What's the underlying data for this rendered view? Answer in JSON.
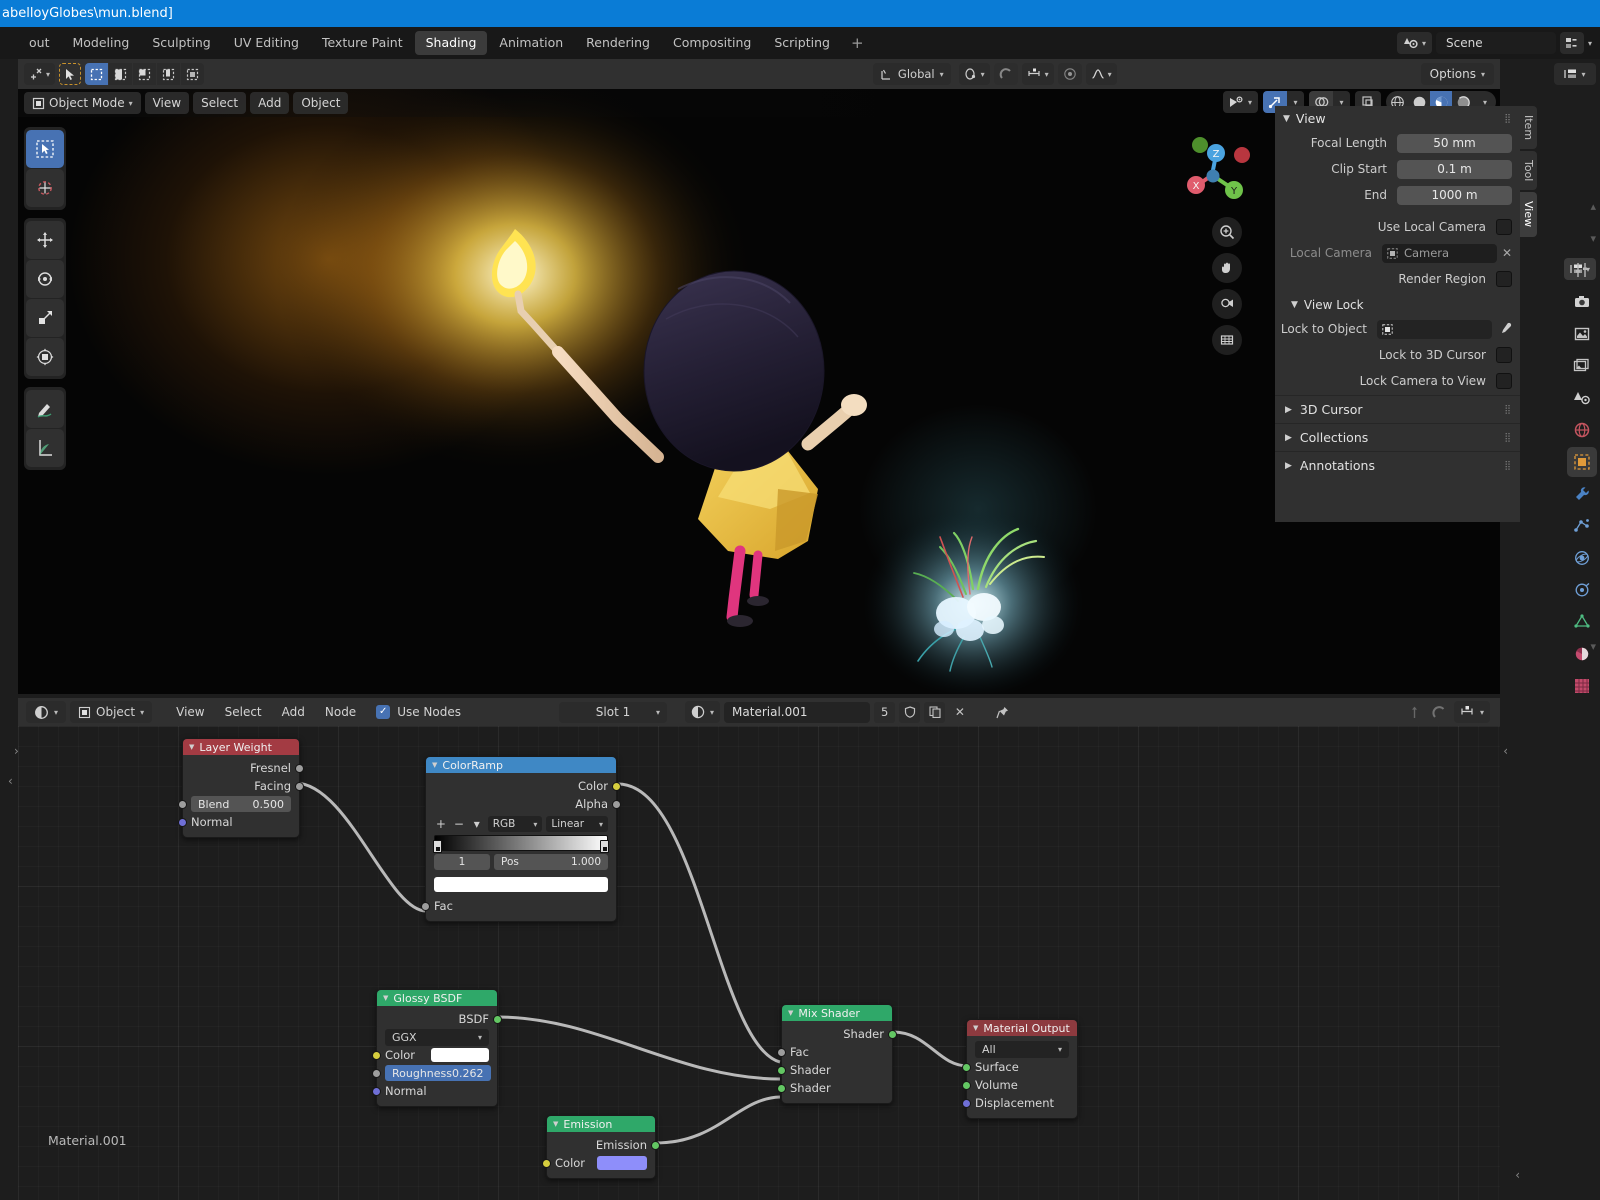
{
  "window": {
    "title": "abelloyGlobes\\mun.blend]"
  },
  "topbar": {
    "tabs": [
      {
        "label": "out",
        "active": false
      },
      {
        "label": "Modeling",
        "active": false
      },
      {
        "label": "Sculpting",
        "active": false
      },
      {
        "label": "UV Editing",
        "active": false
      },
      {
        "label": "Texture Paint",
        "active": false
      },
      {
        "label": "Shading",
        "active": true
      },
      {
        "label": "Animation",
        "active": false
      },
      {
        "label": "Rendering",
        "active": false
      },
      {
        "label": "Compositing",
        "active": false
      },
      {
        "label": "Scripting",
        "active": false
      },
      {
        "label": "+",
        "active": false
      }
    ],
    "scene_name": "Scene",
    "scene_icon": "scene-data-icon",
    "viewlayer_icon": "view-layer-icon"
  },
  "viewport_tools": {
    "cursor_icon": "transform-cursor-icon",
    "tweak_icon": "tweak-select-icon",
    "select_modes": [
      "select-box-icon",
      "select-extend-icon",
      "select-subtract-icon",
      "select-invert-icon",
      "select-intersect-icon"
    ],
    "orientation": "Global",
    "orientation_icon": "orientation-axis-icon",
    "pivot_icon": "pivot-point-icon",
    "snap_icon": "snap-magnet-icon",
    "snap_to_icon": "snap-increment-icon",
    "proportional_icon": "proportional-edit-icon",
    "falloff_icon": "falloff-curve-icon",
    "options_label": "Options",
    "editortype_icon": "editor-type-icon"
  },
  "viewport_header": {
    "mode": "Object Mode",
    "mode_icon": "object-mode-icon",
    "menus": [
      "View",
      "Select",
      "Add",
      "Object"
    ],
    "visibility_icon": "show-hide-icon",
    "gizmo_icon": "gizmo-icon",
    "overlay_icon": "overlays-icon",
    "xray_icon": "xray-toggle-icon",
    "shading_modes": [
      "wireframe-icon",
      "solid-icon",
      "material-preview-icon",
      "rendered-icon"
    ],
    "shading_active_index": 2
  },
  "toolbar": {
    "tools": [
      {
        "name": "tweak-tool",
        "active": true
      },
      {
        "name": "cursor-tool",
        "active": false
      },
      {
        "name": "move-tool",
        "active": false
      },
      {
        "name": "rotate-tool",
        "active": false
      },
      {
        "name": "scale-tool",
        "active": false
      },
      {
        "name": "transform-tool",
        "active": false
      },
      {
        "name": "annotate-tool",
        "active": false
      },
      {
        "name": "measure-tool",
        "active": false
      }
    ]
  },
  "gizmo": {
    "axes": [
      "X",
      "Y",
      "Z"
    ],
    "nav_buttons": [
      "zoom-icon",
      "pan-hand-icon",
      "camera-view-icon",
      "orthographic-icon"
    ]
  },
  "sidebar": {
    "tabs": [
      {
        "label": "Item",
        "active": false
      },
      {
        "label": "Tool",
        "active": false
      },
      {
        "label": "View",
        "active": true
      }
    ],
    "view_panel": {
      "title": "View",
      "focal_length_label": "Focal Length",
      "focal_length_value": "50 mm",
      "clip_start_label": "Clip Start",
      "clip_start_value": "0.1 m",
      "end_label": "End",
      "end_value": "1000 m",
      "use_local_camera_label": "Use Local Camera",
      "local_camera_label": "Local Camera",
      "local_camera_value": "Camera",
      "render_region_label": "Render Region"
    },
    "view_lock": {
      "title": "View Lock",
      "lock_to_object_label": "Lock to Object",
      "lock_to_object_value": "",
      "lock_to_3d_cursor_label": "Lock to 3D Cursor",
      "lock_camera_to_view_label": "Lock Camera to View"
    },
    "sections": [
      {
        "label": "3D Cursor"
      },
      {
        "label": "Collections"
      },
      {
        "label": "Annotations"
      }
    ]
  },
  "properties_rail": {
    "icons": [
      "tool-properties-icon",
      "render-properties-icon",
      "output-properties-icon",
      "view-layer-properties-icon",
      "scene-properties-icon",
      "world-properties-icon",
      "object-properties-icon",
      "modifier-properties-icon",
      "particles-properties-icon",
      "physics-properties-icon",
      "constraints-properties-icon",
      "data-properties-icon",
      "material-properties-icon",
      "texture-properties-icon"
    ],
    "selected": "object-properties-icon"
  },
  "shader_editor": {
    "editor_icon": "shader-editor-icon",
    "shader_type": "Object",
    "shader_type_icon": "object-icon",
    "menus": [
      "View",
      "Select",
      "Add",
      "Node"
    ],
    "use_nodes_label": "Use Nodes",
    "use_nodes_checked": true,
    "slot": "Slot 1",
    "material_icon": "material-sphere-icon",
    "material_name": "Material.001",
    "material_users": "5",
    "fake_user_icon": "shield-fake-user-icon",
    "new_material_icon": "duplicate-material-icon",
    "unlink_icon": "unlink-x-icon",
    "pin_icon": "pin-icon",
    "snap_node_icon": "node-snap-icon",
    "overlay_node_icon": "node-overlay-icon",
    "proportional_node_icon": "node-proportional-icon",
    "status_label": "Material.001"
  },
  "nodes": [
    {
      "name": "Layer Weight",
      "header_color": "#a33b43",
      "outputs": [
        {
          "label": "Fresnel",
          "socket": "grey"
        },
        {
          "label": "Facing",
          "socket": "grey"
        }
      ],
      "properties": [
        {
          "label": "Blend",
          "value": "0.500"
        }
      ],
      "inputs": [
        {
          "label": "Normal",
          "socket": "purple"
        }
      ]
    },
    {
      "name": "ColorRamp",
      "header_color": "#3f88c5",
      "outputs": [
        {
          "label": "Color",
          "socket": "yellow"
        },
        {
          "label": "Alpha",
          "socket": "grey"
        }
      ],
      "color_mode": "RGB",
      "interpolation": "Linear",
      "index": "1",
      "pos_label": "Pos",
      "pos_value": "1.000",
      "inputs": [
        {
          "label": "Fac",
          "socket": "grey"
        }
      ]
    },
    {
      "name": "Glossy BSDF",
      "header_color": "#2fa869",
      "outputs": [
        {
          "label": "BSDF",
          "socket": "green"
        }
      ],
      "distribution": "GGX",
      "inputs": [
        {
          "label": "Color",
          "socket": "yellow",
          "swatch": "#ffffff"
        },
        {
          "label": "Roughness",
          "socket": "grey",
          "value": "0.262",
          "selected": true
        },
        {
          "label": "Normal",
          "socket": "purple"
        }
      ]
    },
    {
      "name": "Mix Shader",
      "header_color": "#2fa869",
      "outputs": [
        {
          "label": "Shader",
          "socket": "green"
        }
      ],
      "inputs": [
        {
          "label": "Fac",
          "socket": "grey"
        },
        {
          "label": "Shader",
          "socket": "green"
        },
        {
          "label": "Shader",
          "socket": "green"
        }
      ]
    },
    {
      "name": "Material Output",
      "header_color": "#8d3a3f",
      "target": "All",
      "inputs": [
        {
          "label": "Surface",
          "socket": "green"
        },
        {
          "label": "Volume",
          "socket": "green"
        },
        {
          "label": "Displacement",
          "socket": "purple"
        }
      ]
    },
    {
      "name": "Emission",
      "header_color": "#2fa869",
      "outputs": [
        {
          "label": "Emission",
          "socket": "green"
        }
      ],
      "inputs": [
        {
          "label": "Color",
          "socket": "yellow",
          "swatch": "#8e8efa"
        }
      ]
    }
  ]
}
